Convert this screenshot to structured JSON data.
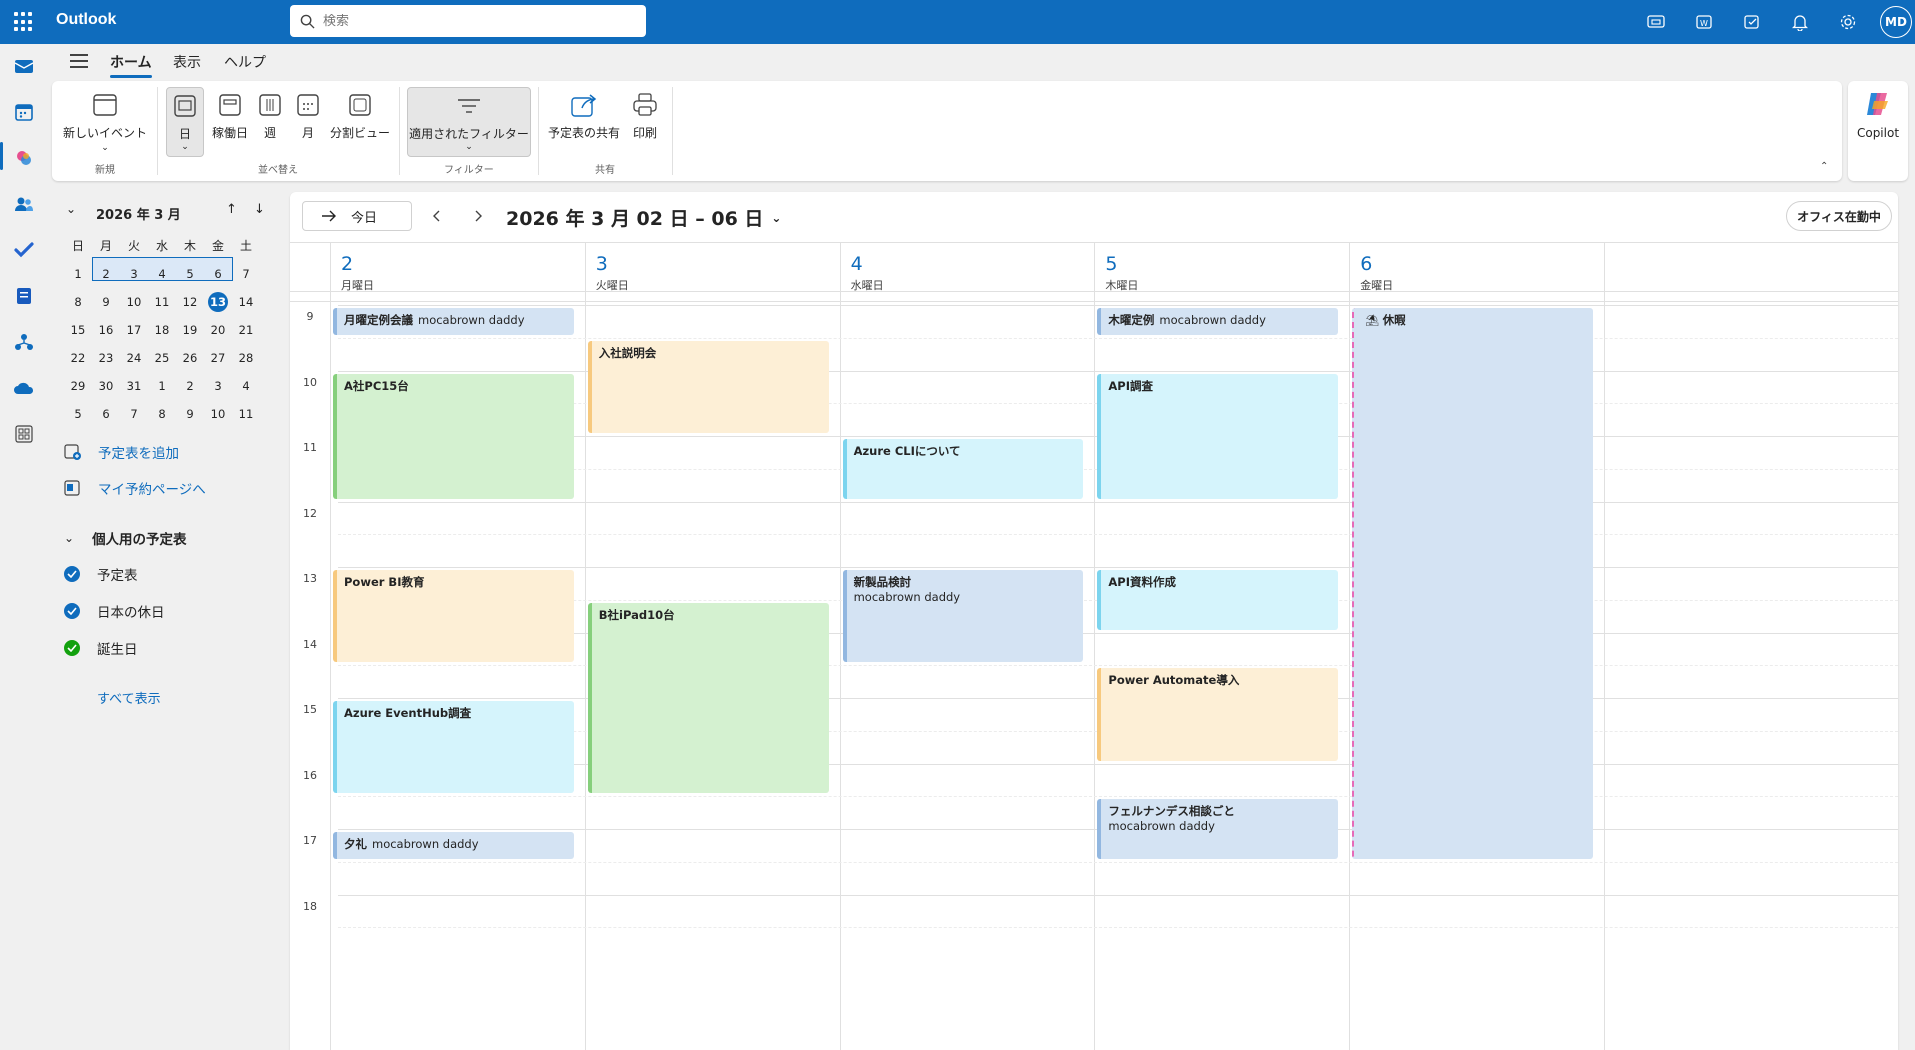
{
  "app": {
    "title": "Outlook"
  },
  "search": {
    "placeholder": "検索"
  },
  "user": {
    "initials": "MD"
  },
  "menu": {
    "tabs": [
      "ホーム",
      "表示",
      "ヘルプ"
    ]
  },
  "ribbon": {
    "new_event": "新しいイベント",
    "group_new": "新規",
    "day": "日",
    "workweek": "稼働日",
    "week": "週",
    "month": "月",
    "split": "分割ビュー",
    "group_arrange": "並べ替え",
    "filter": "適用されたフィルター",
    "group_filter": "フィルター",
    "share": "予定表の共有",
    "print": "印刷",
    "group_share": "共有"
  },
  "copilot": {
    "label": "Copilot"
  },
  "minical": {
    "title": "2026 年 3 月",
    "weekdays": [
      "日",
      "月",
      "火",
      "水",
      "木",
      "金",
      "土"
    ],
    "weeks": [
      [
        "1",
        "2",
        "3",
        "4",
        "5",
        "6",
        "7"
      ],
      [
        "8",
        "9",
        "10",
        "11",
        "12",
        "13",
        "14"
      ],
      [
        "15",
        "16",
        "17",
        "18",
        "19",
        "20",
        "21"
      ],
      [
        "22",
        "23",
        "24",
        "25",
        "26",
        "27",
        "28"
      ],
      [
        "29",
        "30",
        "31",
        "1",
        "2",
        "3",
        "4"
      ],
      [
        "5",
        "6",
        "7",
        "8",
        "9",
        "10",
        "11"
      ]
    ],
    "today": "13"
  },
  "sidebar": {
    "add_calendar": "予定表を追加",
    "booking": "マイ予約ページへ",
    "section": "個人用の予定表",
    "calendars": [
      {
        "name": "予定表",
        "color": "#0f6cbd"
      },
      {
        "name": "日本の休日",
        "color": "#0f6cbd"
      },
      {
        "name": "誕生日",
        "color": "#13a10e"
      }
    ],
    "show_all": "すべて表示"
  },
  "toolbar": {
    "today": "今日",
    "range": "2026 年 3 月 02 日 – 06 日",
    "office": "オフィス在勤中"
  },
  "days": [
    {
      "num": "2",
      "name": "月曜日"
    },
    {
      "num": "3",
      "name": "火曜日"
    },
    {
      "num": "4",
      "name": "水曜日"
    },
    {
      "num": "5",
      "name": "木曜日"
    },
    {
      "num": "6",
      "name": "金曜日"
    }
  ],
  "hours": [
    "9",
    "10",
    "11",
    "12",
    "13",
    "14",
    "15",
    "16",
    "17",
    "18"
  ],
  "events": [
    {
      "day": 0,
      "start": 9,
      "end": 9.5,
      "title": "月曜定例会議",
      "sub": "mocabrown daddy",
      "inline": true,
      "color": "blue"
    },
    {
      "day": 0,
      "start": 10,
      "end": 12,
      "title": "A社PC15台",
      "sub": "",
      "color": "green"
    },
    {
      "day": 0,
      "start": 13,
      "end": 14.5,
      "title": "Power BI教育",
      "sub": "",
      "color": "orange"
    },
    {
      "day": 0,
      "start": 15,
      "end": 16.5,
      "title": "Azure EventHub調査",
      "sub": "",
      "color": "cyan"
    },
    {
      "day": 0,
      "start": 17,
      "end": 17.5,
      "title": "夕礼",
      "sub": "mocabrown daddy",
      "inline": true,
      "color": "blue"
    },
    {
      "day": 1,
      "start": 9.5,
      "end": 11,
      "title": "入社説明会",
      "sub": "",
      "color": "orange"
    },
    {
      "day": 1,
      "start": 13.5,
      "end": 16.5,
      "title": "B社iPad10台",
      "sub": "",
      "color": "green"
    },
    {
      "day": 2,
      "start": 11,
      "end": 12,
      "title": "Azure CLIについて",
      "sub": "",
      "color": "cyan"
    },
    {
      "day": 2,
      "start": 13,
      "end": 14.5,
      "title": "新製品検討",
      "sub": "mocabrown daddy",
      "color": "blue"
    },
    {
      "day": 3,
      "start": 9,
      "end": 9.5,
      "title": "木曜定例",
      "sub": "mocabrown daddy",
      "inline": true,
      "color": "blue"
    },
    {
      "day": 3,
      "start": 10,
      "end": 12,
      "title": "API調査",
      "sub": "",
      "color": "cyan"
    },
    {
      "day": 3,
      "start": 13,
      "end": 14,
      "title": "API資料作成",
      "sub": "",
      "color": "cyan"
    },
    {
      "day": 3,
      "start": 14.5,
      "end": 16,
      "title": "Power Automate導入",
      "sub": "",
      "color": "orange"
    },
    {
      "day": 3,
      "start": 16.5,
      "end": 17.5,
      "title": "フェルナンデス相談ごと",
      "sub": "mocabrown daddy",
      "color": "blue"
    },
    {
      "day": 4,
      "start": 9,
      "end": 17.5,
      "title": "休暇",
      "sub": "",
      "color": "vac"
    }
  ]
}
